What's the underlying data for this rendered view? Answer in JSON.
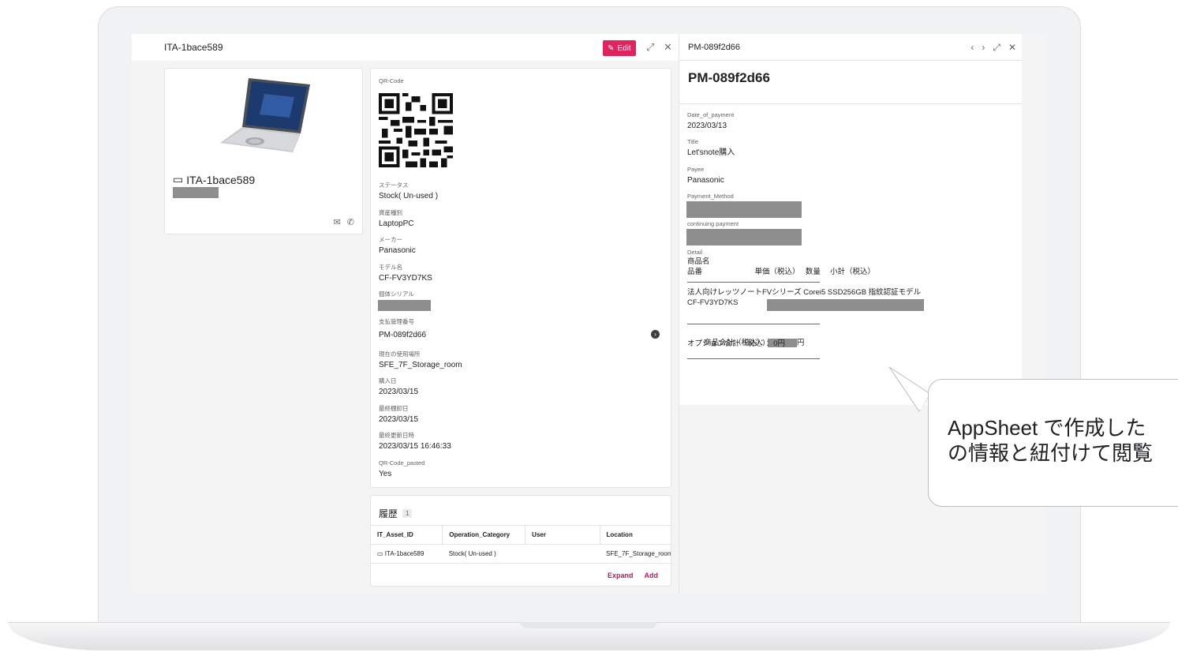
{
  "left_pane": {
    "header_title": "ITA-1bace589",
    "edit_label": "Edit",
    "asset": {
      "name": "ITA-1bace589"
    },
    "fields": [
      {
        "label": "QR-Code",
        "value": ""
      },
      {
        "label": "ステータス",
        "value": "Stock( Un-used )"
      },
      {
        "label": "資産種別",
        "value": "LaptopPC"
      },
      {
        "label": "メーカー",
        "value": "Panasonic"
      },
      {
        "label": "モデル名",
        "value": "CF-FV3YD7KS"
      },
      {
        "label": "個体シリアル",
        "value": ""
      },
      {
        "label": "支払管理番号",
        "value": "PM-089f2d66"
      },
      {
        "label": "現在の使用場所",
        "value": "SFE_7F_Storage_room"
      },
      {
        "label": "購入日",
        "value": "2023/03/15"
      },
      {
        "label": "最終棚卸日",
        "value": "2023/03/15"
      },
      {
        "label": "最終更新日時",
        "value": "2023/03/15 16:46:33"
      },
      {
        "label": "QR-Code_pasted",
        "value": "Yes"
      }
    ],
    "history": {
      "title": "履歴",
      "count": "1",
      "columns": [
        "IT_Asset_ID",
        "Operation_Category",
        "User",
        "Location"
      ],
      "rows": [
        [
          "ITA-1bace589",
          "Stock( Un-used )",
          "",
          "SFE_7F_Storage_room"
        ]
      ],
      "expand_label": "Expand",
      "add_label": "Add"
    }
  },
  "right_pane": {
    "header_title": "PM-089f2d66",
    "title": "PM-089f2d66",
    "fields": [
      {
        "label": "Date_of_payment",
        "value": "2023/03/13"
      },
      {
        "label": "Title",
        "value": "Let'snote購入"
      },
      {
        "label": "Payee",
        "value": "Panasonic"
      },
      {
        "label": "Payment_Method",
        "value": ""
      },
      {
        "label": "continuing payment",
        "value": ""
      }
    ],
    "detail_label": "Detail",
    "detail_header_1": "商品名",
    "detail_header_2": "品番　　　　　　　単価（税込）　 数量　 小計（税込）",
    "detail_item_1": "法人向けレッツノートFVシリーズ Corei5 SSD256GB 指紋認証モデル",
    "detail_item_2": "CF-FV3YD7KS",
    "total_prefix": "商品合計（税込）：",
    "total_suffix": "円",
    "option_total": "オプション合計（税込）：0円"
  },
  "callout": {
    "line1": "AppSheet で作成した",
    "line2": "の情報と紐付けて閲覧"
  },
  "colors": {
    "accent": "#e0245e",
    "link": "#c2185b",
    "redaction": "#8e8e8e"
  }
}
